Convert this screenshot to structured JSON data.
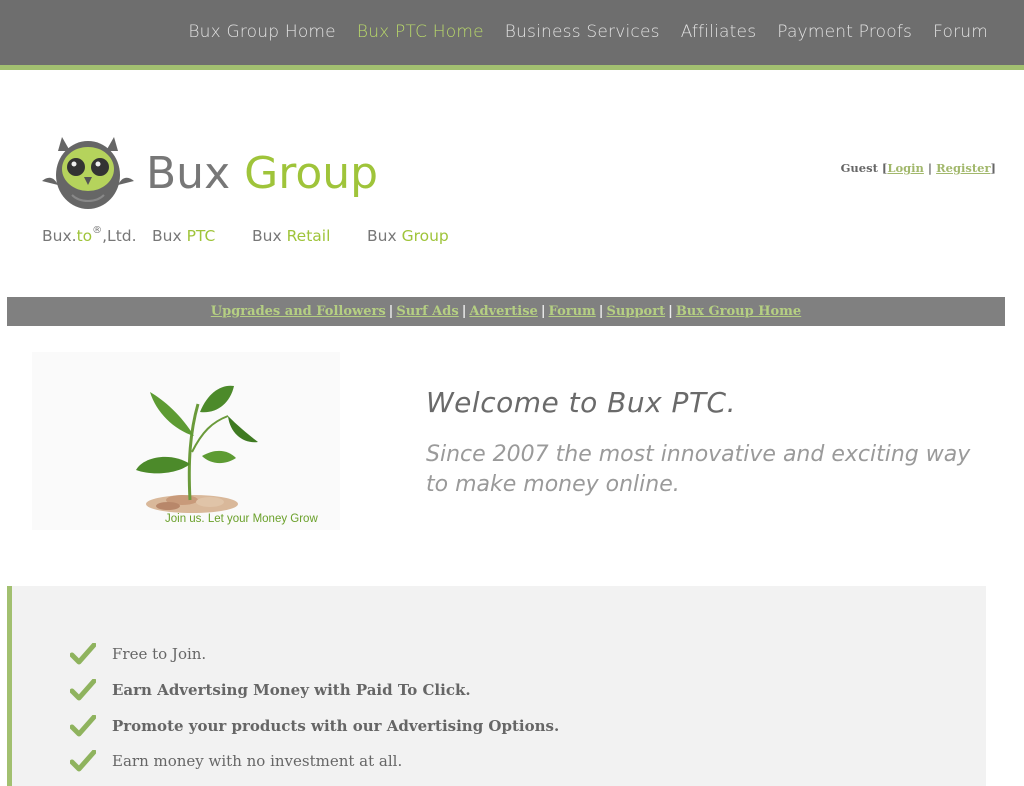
{
  "topnav": {
    "items": [
      {
        "label": "Bux Group Home"
      },
      {
        "label": "Bux PTC Home"
      },
      {
        "label": "Business Services"
      },
      {
        "label": "Affiliates"
      },
      {
        "label": "Payment Proofs"
      },
      {
        "label": "Forum"
      }
    ]
  },
  "brand": {
    "word1": "Bux",
    "word2": "Group"
  },
  "sublinks": {
    "buxto_prefix": "Bux.",
    "buxto_accent": "to",
    "buxto_reg": "®",
    "buxto_suffix": ",Ltd.",
    "ptc_prefix": "Bux",
    "ptc_accent": "PTC",
    "retail_prefix": "Bux",
    "retail_accent": "Retail",
    "group_prefix": "Bux",
    "group_accent": "Group"
  },
  "guest": {
    "label": "Guest",
    "login": "Login",
    "register": "Register"
  },
  "linkbar": {
    "items": [
      "Upgrades and Followers",
      "Surf Ads",
      "Advertise",
      "Forum",
      "Support",
      "Bux Group Home"
    ]
  },
  "hero": {
    "caption": "Join us. Let your Money Grow"
  },
  "welcome": {
    "title": "Welcome to Bux PTC.",
    "tagline": "Since 2007 the most innovative and exciting way to make money online."
  },
  "features": [
    "Free to Join.",
    "Earn Advertsing Money with Paid To Click.",
    "Promote your products with our Advertising Options.",
    "Earn money with no investment at all."
  ],
  "colors": {
    "accent": "#a2c070",
    "nav_bg": "#6e6e6e"
  }
}
